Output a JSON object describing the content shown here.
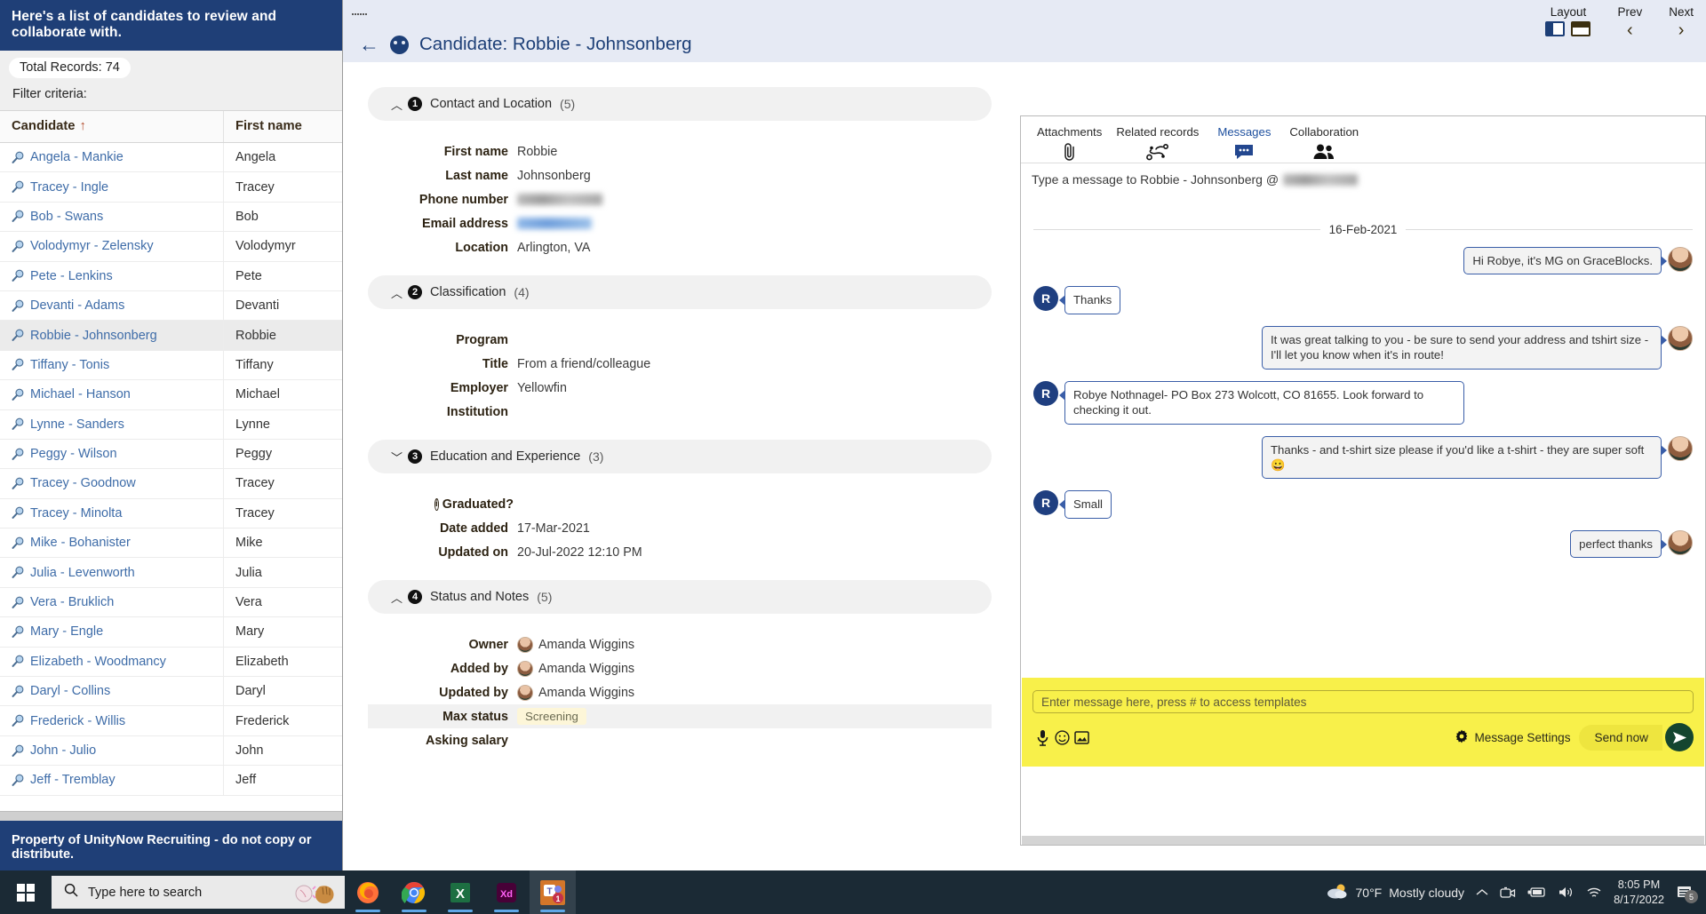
{
  "sidebar": {
    "banner": "Here's a list of candidates to review and collaborate with.",
    "total_records": "Total Records: 74",
    "filter_criteria": "Filter criteria:",
    "columns": {
      "candidate": "Candidate",
      "sort_arrow": "↑",
      "first_name": "First name"
    },
    "rows": [
      {
        "candidate": "Angela - Mankie",
        "first_name": "Angela"
      },
      {
        "candidate": "Tracey - Ingle",
        "first_name": "Tracey"
      },
      {
        "candidate": "Bob - Swans",
        "first_name": "Bob"
      },
      {
        "candidate": "Volodymyr - Zelensky",
        "first_name": "Volodymyr"
      },
      {
        "candidate": "Pete - Lenkins",
        "first_name": "Pete"
      },
      {
        "candidate": "Devanti - Adams",
        "first_name": "Devanti"
      },
      {
        "candidate": "Robbie - Johnsonberg",
        "first_name": "Robbie"
      },
      {
        "candidate": "Tiffany - Tonis",
        "first_name": "Tiffany"
      },
      {
        "candidate": "Michael - Hanson",
        "first_name": "Michael"
      },
      {
        "candidate": "Lynne - Sanders",
        "first_name": "Lynne"
      },
      {
        "candidate": "Peggy - Wilson",
        "first_name": "Peggy"
      },
      {
        "candidate": "Tracey - Goodnow",
        "first_name": "Tracey"
      },
      {
        "candidate": "Tracey - Minolta",
        "first_name": "Tracey"
      },
      {
        "candidate": "Mike - Bohanister",
        "first_name": "Mike"
      },
      {
        "candidate": "Julia - Levenworth",
        "first_name": "Julia"
      },
      {
        "candidate": "Vera - Bruklich",
        "first_name": "Vera"
      },
      {
        "candidate": "Mary - Engle",
        "first_name": "Mary"
      },
      {
        "candidate": "Elizabeth - Woodmancy",
        "first_name": "Elizabeth"
      },
      {
        "candidate": "Daryl - Collins",
        "first_name": "Daryl"
      },
      {
        "candidate": "Frederick - Willis",
        "first_name": "Frederick"
      },
      {
        "candidate": "John - Julio",
        "first_name": "John"
      },
      {
        "candidate": "Jeff - Tremblay",
        "first_name": "Jeff"
      }
    ],
    "selected_row_index": 6,
    "footer": "Property of UnityNow Recruiting - do not copy or distribute."
  },
  "main": {
    "record_title": "Candidate: Robbie - Johnsonberg",
    "layout_label": "Layout",
    "prev_label": "Prev",
    "next_label": "Next",
    "sections": [
      {
        "number": "1",
        "title": "Contact and Location",
        "count": "(5)",
        "expanded": true,
        "fields": [
          {
            "label": "First name",
            "value": "Robbie",
            "type": "text"
          },
          {
            "label": "Last name",
            "value": "Johnsonberg",
            "type": "text"
          },
          {
            "label": "Phone number",
            "value": "",
            "type": "redacted-phone"
          },
          {
            "label": "Email address",
            "value": "",
            "type": "redacted-email"
          },
          {
            "label": "Location",
            "value": "Arlington, VA",
            "type": "text"
          }
        ]
      },
      {
        "number": "2",
        "title": "Classification",
        "count": "(4)",
        "expanded": true,
        "fields": [
          {
            "label": "Program",
            "value": "",
            "type": "text"
          },
          {
            "label": "Title",
            "value": "From a friend/colleague",
            "type": "text"
          },
          {
            "label": "Employer",
            "value": "Yellowfin",
            "type": "text"
          },
          {
            "label": "Institution",
            "value": "",
            "type": "text"
          }
        ]
      },
      {
        "number": "3",
        "title": "Education and Experience",
        "count": "(3)",
        "expanded": false,
        "fields": [
          {
            "label": "Graduated?",
            "value": "",
            "type": "text",
            "info": true
          },
          {
            "label": "Date added",
            "value": "17-Mar-2021",
            "type": "text"
          },
          {
            "label": "Updated on",
            "value": "20-Jul-2022 12:10 PM",
            "type": "text"
          }
        ]
      },
      {
        "number": "4",
        "title": "Status and Notes",
        "count": "(5)",
        "expanded": true,
        "fields": [
          {
            "label": "Owner",
            "value": "Amanda Wiggins",
            "type": "user"
          },
          {
            "label": "Added by",
            "value": "Amanda Wiggins",
            "type": "user"
          },
          {
            "label": "Updated by",
            "value": "Amanda Wiggins",
            "type": "user"
          },
          {
            "label": "Max status",
            "value": "Screening",
            "type": "status"
          },
          {
            "label": "Asking salary",
            "value": "",
            "type": "text"
          }
        ]
      }
    ]
  },
  "messages": {
    "tabs": [
      {
        "label": "Attachments",
        "icon": "paperclip-icon",
        "active": false
      },
      {
        "label": "Related records",
        "icon": "related-records-icon",
        "active": false
      },
      {
        "label": "Messages",
        "icon": "chat-bubble-icon",
        "active": true
      },
      {
        "label": "Collaboration",
        "icon": "people-icon",
        "active": false
      }
    ],
    "to_prefix": "Type a message to Robbie - Johnsonberg @",
    "date_separator": "16-Feb-2021",
    "thread": [
      {
        "dir": "out",
        "text": "Hi Robye, it's MG on GraceBlocks.",
        "avatar": "photo"
      },
      {
        "dir": "in",
        "text": "Thanks",
        "avatar": "R"
      },
      {
        "dir": "out",
        "text": "It was great talking to you - be sure to send your address and tshirt size - I'll let you know when it's in route!",
        "avatar": "photo"
      },
      {
        "dir": "in",
        "text": "Robye Nothnagel- PO Box 273 Wolcott, CO 81655. Look forward to checking it out.",
        "avatar": "R"
      },
      {
        "dir": "out",
        "text": "Thanks - and t-shirt size please if you'd like a t-shirt - they are super soft 😀",
        "avatar": "photo"
      },
      {
        "dir": "in",
        "text": "Small",
        "avatar": "R"
      },
      {
        "dir": "out",
        "text": "perfect thanks",
        "avatar": "photo"
      }
    ],
    "composer": {
      "placeholder": "Enter message here, press # to access templates",
      "settings_label": "Message Settings",
      "send_label": "Send now",
      "icons": [
        "microphone-icon",
        "emoji-icon",
        "image-icon"
      ]
    }
  },
  "taskbar": {
    "search_placeholder": "Type here to search",
    "apps": [
      "firefox-icon",
      "chrome-icon",
      "excel-icon",
      "xd-icon",
      "teams-icon"
    ],
    "teams_badge": "1",
    "weather_temp": "70°F",
    "weather_desc": "Mostly cloudy",
    "time": "8:05 PM",
    "date": "8/17/2022",
    "notification_count": "5"
  },
  "colors": {
    "navy": "#1f3f77",
    "link": "#3e6ca8",
    "accent_blue": "#1d4f9e",
    "composer_yellow": "#f8f04a"
  }
}
